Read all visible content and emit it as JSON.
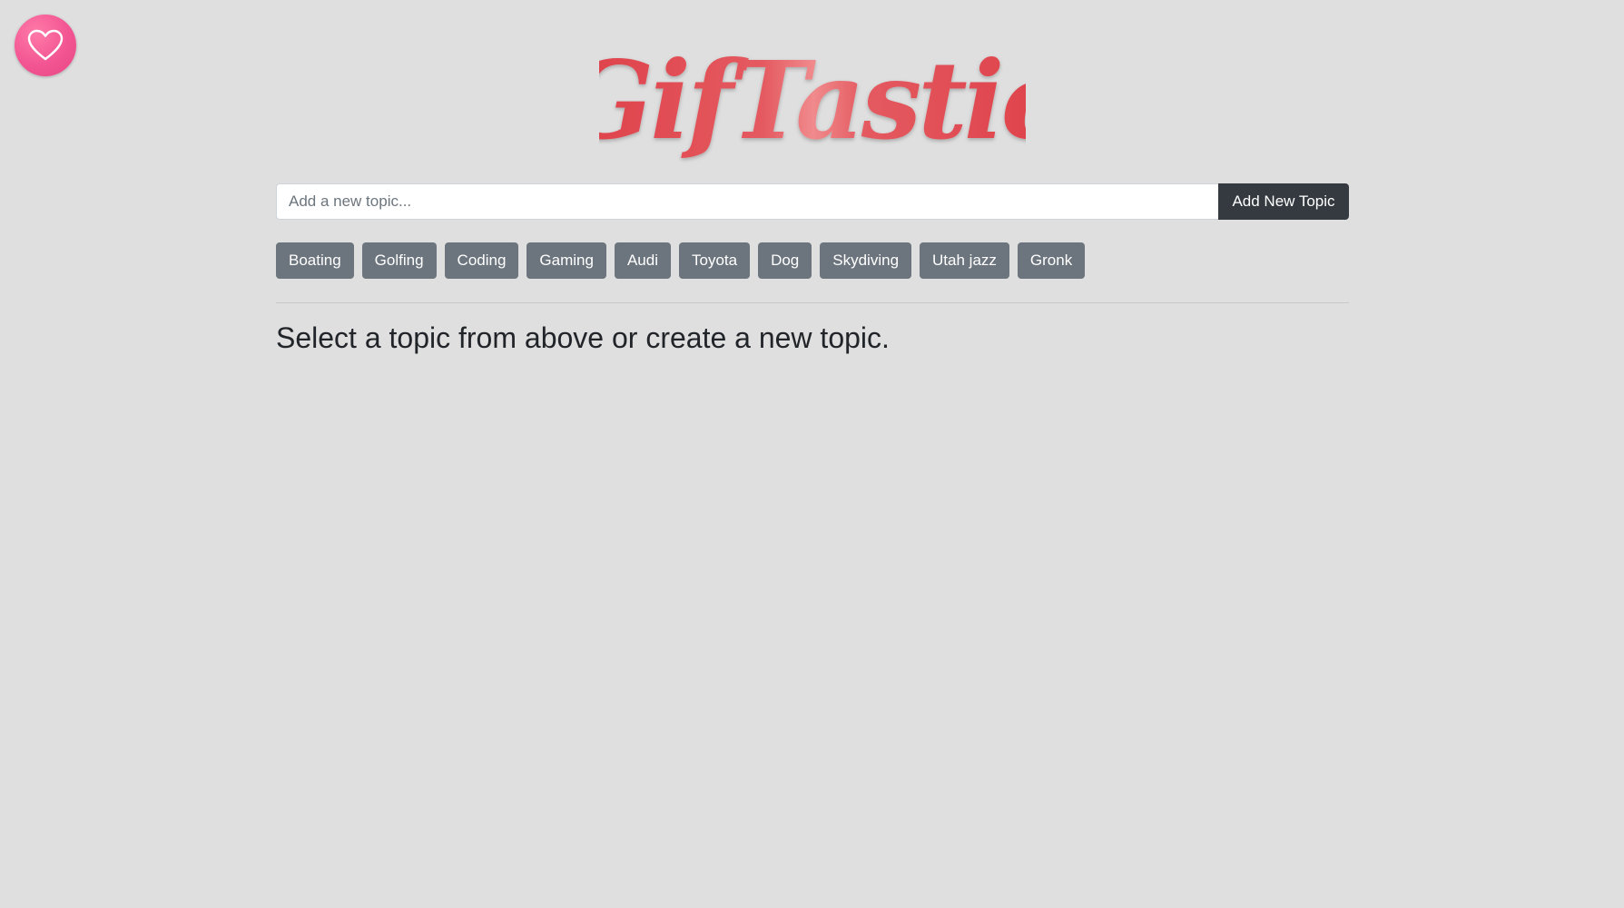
{
  "favorites": {
    "icon": "heart-icon"
  },
  "logo": {
    "text": "GifTastic",
    "color": "#e0454f"
  },
  "search": {
    "placeholder": "Add a new topic...",
    "value": "",
    "button_label": "Add New Topic"
  },
  "topics": [
    "Boating",
    "Golfing",
    "Coding",
    "Gaming",
    "Audi",
    "Toyota",
    "Dog",
    "Skydiving",
    "Utah jazz",
    "Gronk"
  ],
  "main": {
    "prompt": "Select a topic from above or create a new topic."
  },
  "colors": {
    "background": "#dfdfdf",
    "topic_button": "#6c757d",
    "add_button": "#343a40",
    "favorites_button": "#f25592"
  }
}
